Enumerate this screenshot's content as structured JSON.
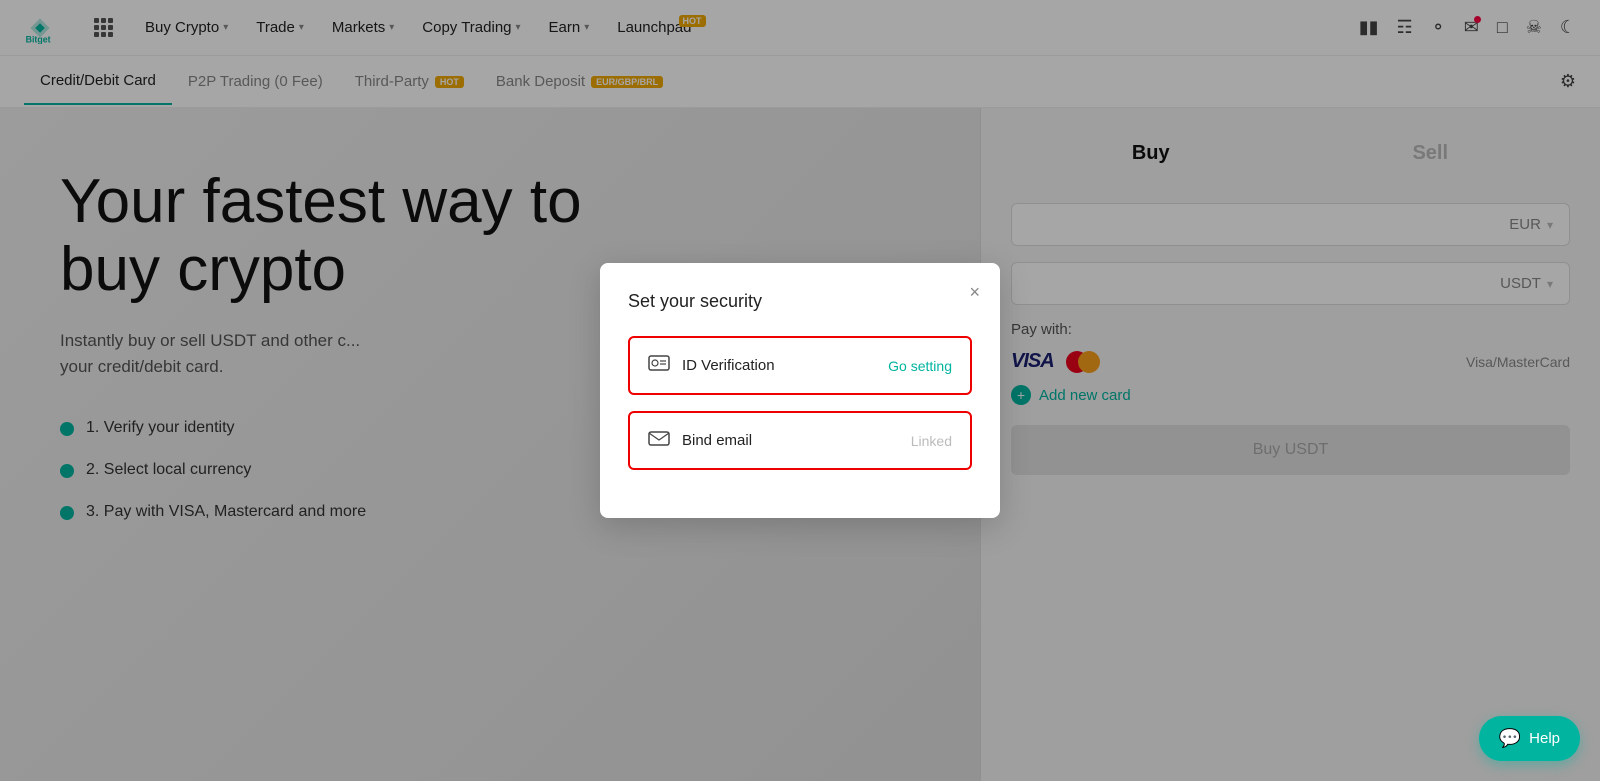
{
  "brand": "Bitget",
  "nav": {
    "items": [
      {
        "label": "Buy Crypto",
        "hasChevron": true
      },
      {
        "label": "Trade",
        "hasChevron": true
      },
      {
        "label": "Markets",
        "hasChevron": true
      },
      {
        "label": "Copy Trading",
        "hasChevron": true
      },
      {
        "label": "Earn",
        "hasChevron": true
      },
      {
        "label": "Launchpad",
        "hasChevron": false,
        "badge": "HOT"
      }
    ]
  },
  "subnav": {
    "items": [
      {
        "label": "Credit/Debit Card",
        "active": true
      },
      {
        "label": "P2P Trading (0 Fee)",
        "active": false
      },
      {
        "label": "Third-Party",
        "active": false,
        "badge": "HOT"
      },
      {
        "label": "Bank Deposit",
        "active": false,
        "badge": "EUR/GBP/BRL"
      }
    ]
  },
  "hero": {
    "title_line1": "Your fastest way to",
    "title_line2": "buy crypto",
    "subtitle": "Instantly buy or sell USDT and other c...\nyour credit/debit card.",
    "steps": [
      "1. Verify your identity",
      "2. Select local currency",
      "3. Pay with VISA, Mastercard and more"
    ]
  },
  "buy_sell": {
    "buy_label": "Buy",
    "sell_label": "Sell",
    "currency_label": "EUR",
    "asset_label": "USDT",
    "pay_with_label": "Pay with:",
    "visa_label": "VISA",
    "mc_label": "Mastercard",
    "payment_method_label": "Visa/MasterCard",
    "add_card_label": "Add new card",
    "buy_btn_label": "Buy USDT"
  },
  "modal": {
    "title": "Set your security",
    "close_label": "×",
    "id_verification_label": "ID Verification",
    "id_action_label": "Go setting",
    "bind_email_label": "Bind email",
    "bind_email_status": "Linked"
  },
  "help": {
    "label": "Help"
  }
}
